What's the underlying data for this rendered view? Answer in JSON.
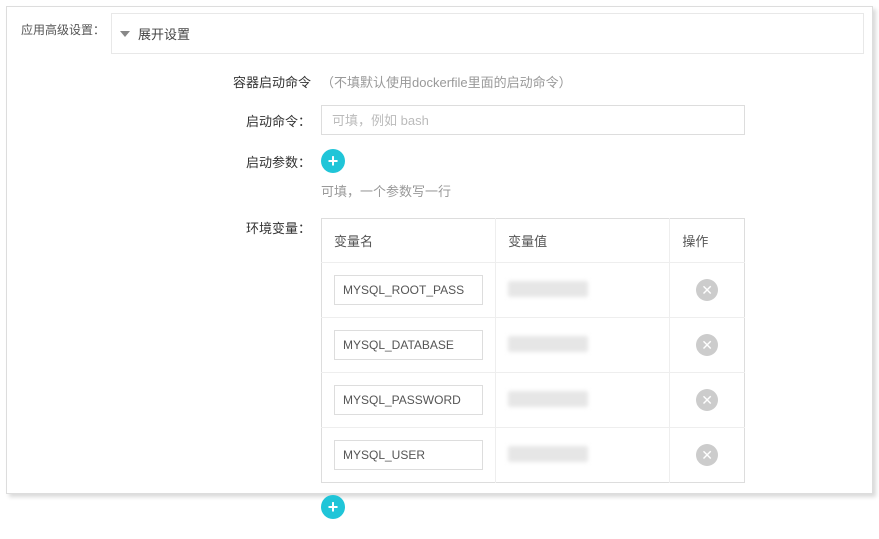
{
  "section": {
    "label": "应用高级设置："
  },
  "expand": {
    "title": "展开设置"
  },
  "container_cmd": {
    "title": "容器启动命令",
    "hint": "（不填默认使用dockerfile里面的启动命令）",
    "cmd_label": "启动命令：",
    "cmd_placeholder": "可填，例如 bash",
    "args_label": "启动参数：",
    "args_hint": "可填，一个参数写一行"
  },
  "env": {
    "label": "环境变量：",
    "col_name": "变量名",
    "col_value": "变量值",
    "col_op": "操作",
    "rows": [
      {
        "name": "MYSQL_ROOT_PASS",
        "value": ""
      },
      {
        "name": "MYSQL_DATABASE",
        "value": ""
      },
      {
        "name": "MYSQL_PASSWORD",
        "value": ""
      },
      {
        "name": "MYSQL_USER",
        "value": ""
      }
    ]
  },
  "icons": {
    "plus": "+",
    "close": "✕"
  }
}
